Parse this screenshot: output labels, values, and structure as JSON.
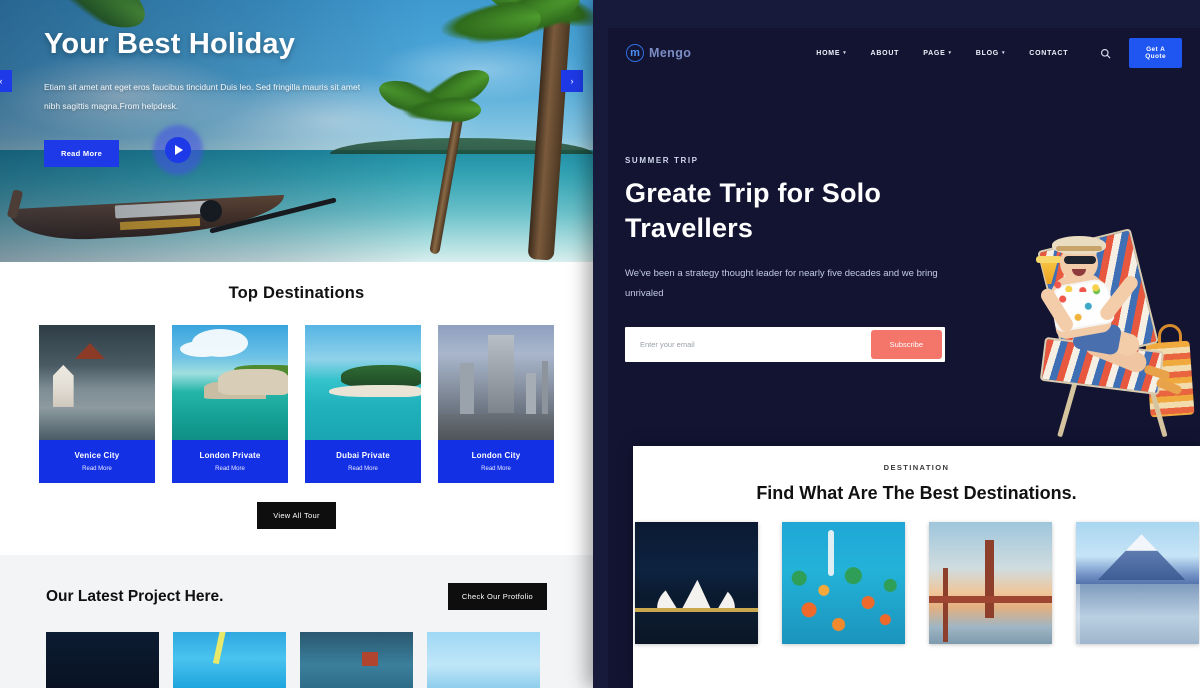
{
  "left_site": {
    "hero": {
      "title": "Your Best Holiday",
      "paragraph": "Etiam sit amet ant eget eros faucibus tincidunt Duis leo. Sed fringilla mauris sit amet nibh sagittis magna.From helpdesk.",
      "read_more_label": "Read More",
      "play_icon": "play-icon",
      "prev_arrow": "‹",
      "next_arrow": "›"
    },
    "destinations": {
      "title": "Top Destinations",
      "cards": [
        {
          "name": "Venice City",
          "link": "Read More",
          "image": "venice-canal-houses"
        },
        {
          "name": "London Private",
          "link": "Read More",
          "image": "tropical-rocky-coast"
        },
        {
          "name": "Dubai Private",
          "link": "Read More",
          "image": "island-beach-pier"
        },
        {
          "name": "London City",
          "link": "Read More",
          "image": "city-skyline-highway"
        }
      ],
      "view_all_label": "View All Tour"
    },
    "projects": {
      "title": "Our Latest Project Here.",
      "portfolio_label": "Check Our Protfolio",
      "thumbs": [
        "night-dark-scene",
        "bright-blue-sea",
        "sunset-harbour",
        "snow-mountain-sky"
      ]
    }
  },
  "right_site": {
    "nav": {
      "logo_mark": "m",
      "logo_text": "Mengo",
      "links": [
        {
          "label": "HOME",
          "has_caret": true
        },
        {
          "label": "ABOUT",
          "has_caret": false
        },
        {
          "label": "PAGE",
          "has_caret": true
        },
        {
          "label": "BLOG",
          "has_caret": true
        },
        {
          "label": "CONTACT",
          "has_caret": false
        }
      ],
      "search_icon": "search-icon",
      "quote_label": "Get A Quote"
    },
    "hero": {
      "eyebrow": "SUMMER TRIP",
      "title": "Greate Trip for Solo Travellers",
      "paragraph": "We've been a strategy thought leader for nearly five decades and we bring unrivaled",
      "email_placeholder": "Enter your email",
      "email_value": "",
      "subscribe_label": "Subscribe",
      "illustration": "man-relaxing-beach-chair"
    },
    "destinations_card": {
      "eyebrow": "DESTINATION",
      "title": "Find What Are The Best Destinations.",
      "images": [
        "sydney-opera-house-night",
        "coral-reef-clownfish",
        "san-francisco-bay-bridge",
        "mount-fuji-city"
      ]
    }
  },
  "colors": {
    "primary_blue": "#1430e4",
    "nav_blue": "#1f55f0",
    "coral": "#f4756a",
    "dark_navy": "#121432",
    "panel_navy": "#181a3c",
    "black_button": "#0e0e0e",
    "light_grey_bg": "#f2f4f6"
  }
}
